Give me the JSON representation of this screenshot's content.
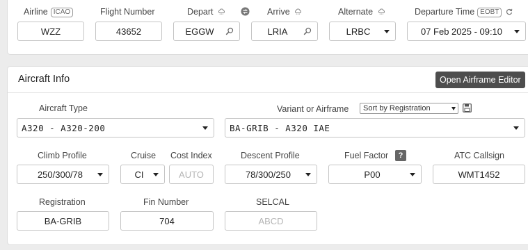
{
  "flight": {
    "airline_label": "Airline",
    "airline_tag": "ICAO",
    "airline_value": "WZZ",
    "flight_number_label": "Flight Number",
    "flight_number_value": "43652",
    "depart_label": "Depart",
    "depart_value": "EGGW",
    "arrive_label": "Arrive",
    "arrive_value": "LRIA",
    "alternate_label": "Alternate",
    "alternate_value": "LRBC",
    "departure_time_label": "Departure Time",
    "departure_time_tag": "EOBT",
    "departure_time_value": "07 Feb 2025 - 09:10"
  },
  "aircraft": {
    "title": "Aircraft Info",
    "open_editor_label": "Open Airframe Editor",
    "type_label": "Aircraft Type",
    "type_value": "A320 - A320-200",
    "variant_label": "Variant or Airframe",
    "sort_value": "Sort by Registration",
    "variant_value": "BA-GRIB - A320 IAE",
    "climb_label": "Climb Profile",
    "climb_value": "250/300/78",
    "cruise_label": "Cruise",
    "cruise_value": "CI",
    "cost_index_label": "Cost Index",
    "cost_index_placeholder": "AUTO",
    "descent_label": "Descent Profile",
    "descent_value": "78/300/250",
    "fuel_factor_label": "Fuel Factor",
    "fuel_factor_help": "?",
    "fuel_factor_value": "P00",
    "atc_callsign_label": "ATC Callsign",
    "atc_callsign_value": "WMT1452",
    "registration_label": "Registration",
    "registration_value": "BA-GRIB",
    "fin_label": "Fin Number",
    "fin_value": "704",
    "selcal_label": "SELCAL",
    "selcal_placeholder": "ABCD"
  }
}
